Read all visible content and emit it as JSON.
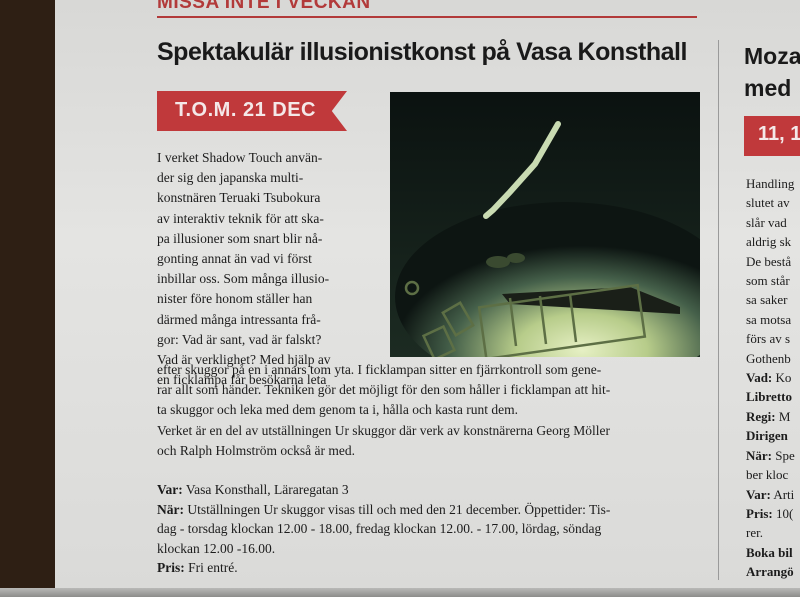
{
  "section_title": "MISSA INTE I VECKAN",
  "headline": "Spektakulär illusionistkonst på Vasa Konsthall",
  "date_badge": "T.O.M. 21 DEC",
  "column_lines": [
    "I verket Shadow Touch använ-",
    "der sig den japanska multi-",
    "konstnären Teruaki Tsubokura",
    "av interaktiv teknik för att ska-",
    "pa illusioner som snart blir nå-",
    "gonting annat än vad vi först",
    "inbillar oss. Som många illusio-",
    "nister före honom ställer han",
    "därmed många intressanta frå-",
    "gor: Vad är sant, vad är falskt?",
    "Vad är verklighet? Med hjälp av",
    "en ficklampa får besökarna leta"
  ],
  "wide_lines": [
    "efter skuggor på en i annars tom yta. I ficklampan sitter en fjärrkontroll som gene-",
    "rar allt som händer. Tekniken gör det möjligt för den som håller i ficklampan att hit-",
    "ta skuggor och leka med dem genom ta i, hålla och kasta runt dem.",
    "Verket är en del av utställningen Ur skuggor där verk av konstnärerna Georg Möller",
    "och Ralph Holmström också är med."
  ],
  "info": {
    "var_label": "Var:",
    "var_value": " Vasa Konsthall, Läraregatan 3",
    "nar_label": "När:",
    "nar_lines": [
      " Utställningen Ur skuggor visas till och med den 21 december. Öppettider: Tis-",
      "dag - torsdag klockan 12.00 - 18.00, fredag klockan 12.00. - 17.00, lördag, söndag",
      "klockan 12.00 -16.00."
    ],
    "pris_label": "Pris:",
    "pris_value": " Fri entré."
  },
  "right_column": {
    "headline_lines": [
      "Moza",
      "med"
    ],
    "badge": "11, 1",
    "lines": [
      {
        "bold": false,
        "text": "Handling"
      },
      {
        "bold": false,
        "text": "slutet av"
      },
      {
        "bold": false,
        "text": "slår vad"
      },
      {
        "bold": false,
        "text": "aldrig sk"
      },
      {
        "bold": false,
        "text": "De bestå"
      },
      {
        "bold": false,
        "text": "som står"
      },
      {
        "bold": false,
        "text": "sa saker"
      },
      {
        "bold": false,
        "text": "sa motsa"
      },
      {
        "bold": false,
        "text": "förs av s"
      },
      {
        "bold": false,
        "text": "Gothenb"
      },
      {
        "bold": true,
        "text": "Vad:",
        "rest": " Ko"
      },
      {
        "bold": true,
        "text": "Libretto"
      },
      {
        "bold": true,
        "text": "Regi:",
        "rest": " M"
      },
      {
        "bold": true,
        "text": "Dirigen"
      },
      {
        "bold": true,
        "text": "När:",
        "rest": " Spe"
      },
      {
        "bold": false,
        "text": "ber kloc"
      },
      {
        "bold": true,
        "text": "Var:",
        "rest": " Arti"
      },
      {
        "bold": true,
        "text": "Pris:",
        "rest": " 10("
      },
      {
        "bold": false,
        "text": "rer."
      },
      {
        "bold": true,
        "text": "Boka bil"
      },
      {
        "bold": true,
        "text": "Arrangö"
      }
    ]
  },
  "colors": {
    "accent": "#c0393b",
    "paper": "#dcdcdc",
    "ink": "#1c1c1c"
  }
}
